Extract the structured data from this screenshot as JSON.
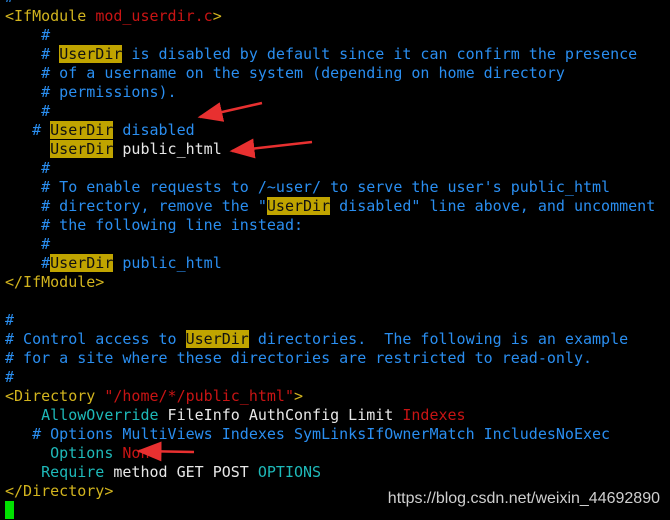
{
  "editor": {
    "lines": [
      [
        [
          "#",
          "cmt"
        ]
      ],
      [
        [
          "<IfModule ",
          "tag"
        ],
        [
          "mod_userdir.c",
          "str"
        ],
        [
          ">",
          "tag"
        ]
      ],
      [
        [
          "    #",
          "cmt"
        ]
      ],
      [
        [
          "    # ",
          "cmt"
        ],
        [
          "UserDir",
          "hl"
        ],
        [
          " is disabled by default since it can confirm the presence",
          "cmt"
        ]
      ],
      [
        [
          "    # of a username on the system (depending on home directory",
          "cmt"
        ]
      ],
      [
        [
          "    # permissions).",
          "cmt"
        ]
      ],
      [
        [
          "    #",
          "cmt"
        ]
      ],
      [
        [
          "   # ",
          "cmt"
        ],
        [
          "UserDir",
          "hl"
        ],
        [
          " disabled",
          "cmt"
        ]
      ],
      [
        [
          "     ",
          "txt"
        ],
        [
          "UserDir",
          "hl"
        ],
        [
          " public_html",
          "txt"
        ]
      ],
      [
        [
          "    #",
          "cmt"
        ]
      ],
      [
        [
          "    # To enable requests to /~user/ to serve the user's public_html",
          "cmt"
        ]
      ],
      [
        [
          "    # directory, remove the \"",
          "cmt"
        ],
        [
          "UserDir",
          "hl"
        ],
        [
          " disabled\" line above, and uncomment",
          "cmt"
        ]
      ],
      [
        [
          "    # the following line instead:",
          "cmt"
        ]
      ],
      [
        [
          "    #",
          "cmt"
        ]
      ],
      [
        [
          "    #",
          "cmt"
        ],
        [
          "UserDir",
          "hl"
        ],
        [
          " public_html",
          "cmt"
        ]
      ],
      [
        [
          "</IfModule>",
          "tag"
        ]
      ],
      [],
      [
        [
          "#",
          "cmt"
        ]
      ],
      [
        [
          "# Control access to ",
          "cmt"
        ],
        [
          "UserDir",
          "hl"
        ],
        [
          " directories.  The following is an example",
          "cmt"
        ]
      ],
      [
        [
          "# for a site where these directories are restricted to read-only.",
          "cmt"
        ]
      ],
      [
        [
          "#",
          "cmt"
        ]
      ],
      [
        [
          "<Directory ",
          "tag"
        ],
        [
          "\"/home/*/public_html\"",
          "str"
        ],
        [
          ">",
          "tag"
        ]
      ],
      [
        [
          "    ",
          "txt"
        ],
        [
          "AllowOverride",
          "dir"
        ],
        [
          " FileInfo AuthConfig Limit ",
          "txt"
        ],
        [
          "Indexes",
          "str"
        ]
      ],
      [
        [
          "   # Options MultiViews Indexes SymLinksIfOwnerMatch IncludesNoExec",
          "cmt"
        ]
      ],
      [
        [
          "     ",
          "txt"
        ],
        [
          "Options",
          "dir"
        ],
        [
          " ",
          "txt"
        ],
        [
          "None",
          "str"
        ]
      ],
      [
        [
          "    ",
          "txt"
        ],
        [
          "Require",
          "dir"
        ],
        [
          " method GET POST ",
          "txt"
        ],
        [
          "OPTIONS",
          "dir"
        ]
      ],
      [
        [
          "</Directory>",
          "tag"
        ]
      ]
    ],
    "cursor_line": 27
  },
  "watermark": "https://blog.csdn.net/weixin_44692890",
  "colors": {
    "tag": "#d2b41e",
    "string": "#c81414",
    "comment": "#2a8ef0",
    "directive": "#1eb9b9",
    "highlight": "#c0a400",
    "cursor": "#00e000",
    "arrow": "#e83030"
  },
  "annotations": [
    "arrow-icon",
    "arrow-icon",
    "arrow-icon"
  ]
}
